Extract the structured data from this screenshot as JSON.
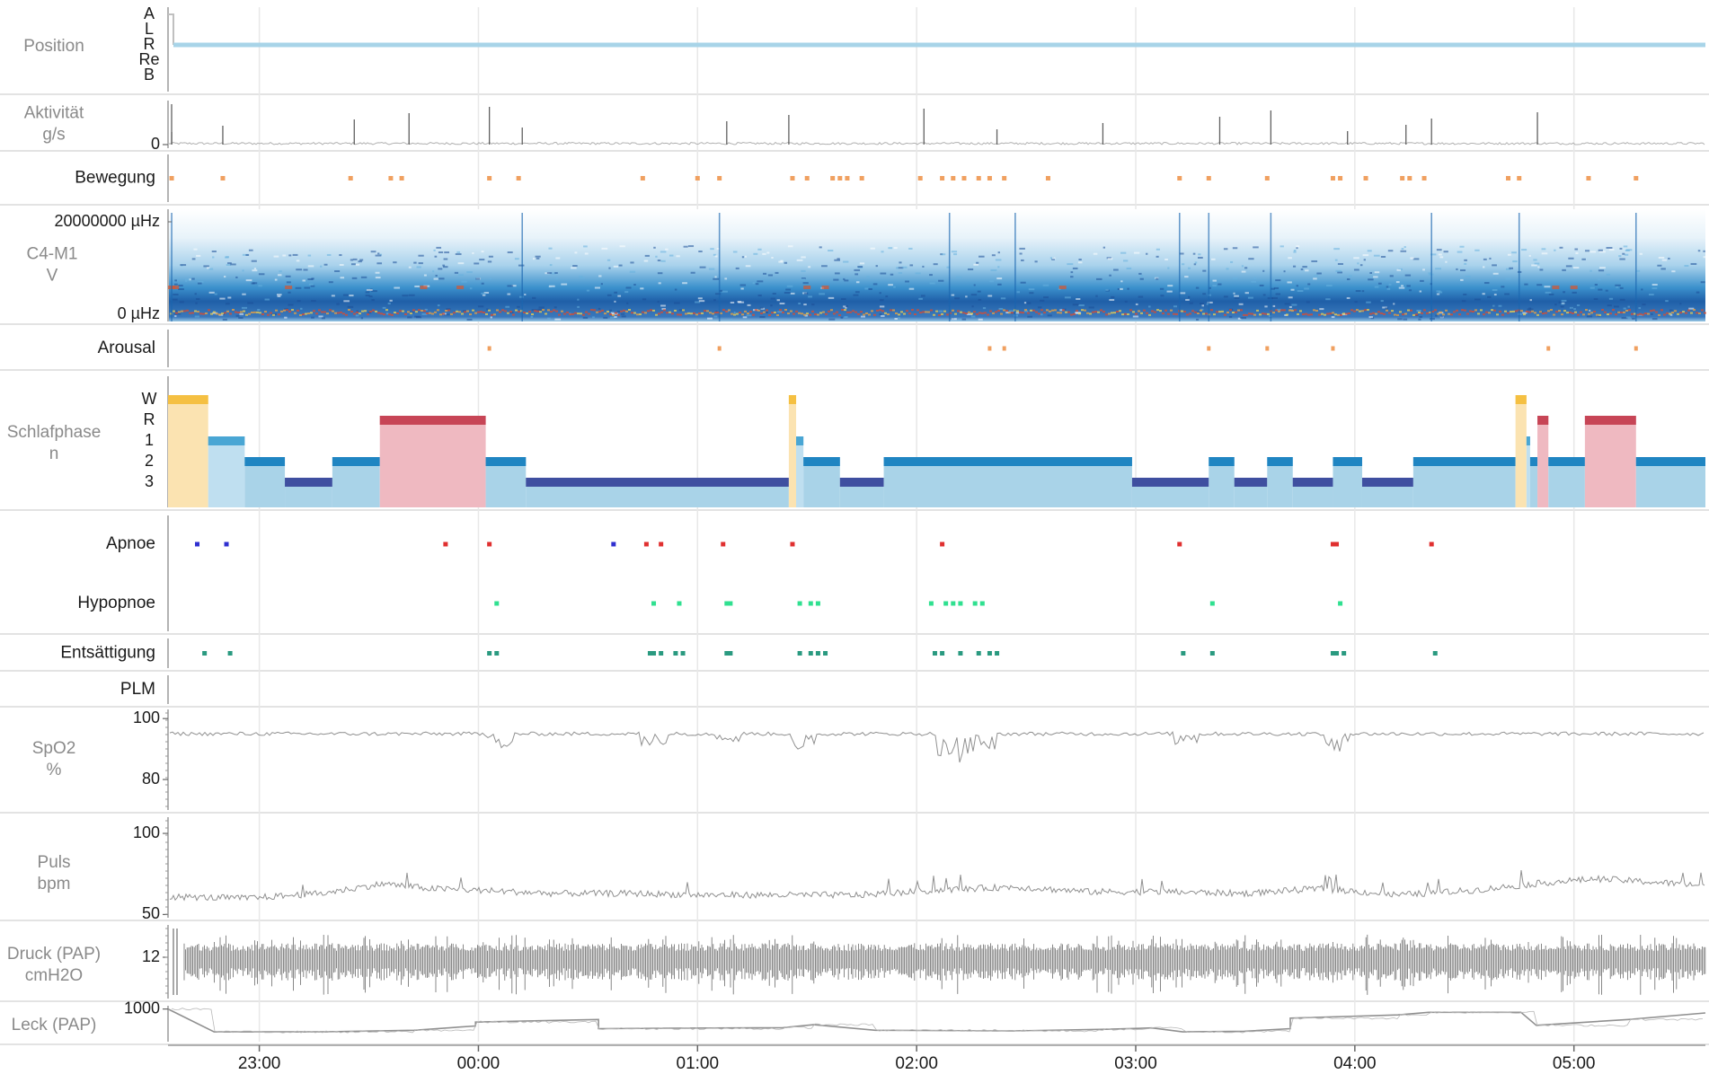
{
  "chart_data": {
    "type": "line",
    "xaxis": {
      "range": [
        "22:35",
        "05:36"
      ],
      "ticks": [
        "23:00",
        "00:00",
        "01:00",
        "02:00",
        "03:00",
        "04:00",
        "05:00"
      ],
      "grid": true
    },
    "panels": [
      {
        "id": "position",
        "label": [
          "Position"
        ],
        "type": "line",
        "yticks": [
          "A",
          "L",
          "R",
          "Re",
          "B"
        ],
        "color": "#a8d4e8",
        "segments": [
          {
            "from": "22:35",
            "to": "22:37",
            "value": "A"
          },
          {
            "from": "22:37",
            "to": "05:36",
            "value": "R"
          }
        ]
      },
      {
        "id": "aktivitaet",
        "label": [
          "Aktivität",
          "g/s"
        ],
        "type": "line",
        "yticks": [
          "0"
        ],
        "color": "#606060",
        "spikes": [
          "22:36",
          "22:50",
          "23:26",
          "23:41",
          "00:03",
          "00:12",
          "01:08",
          "01:25",
          "02:02",
          "02:22",
          "02:51",
          "03:23",
          "03:37",
          "03:58",
          "04:14",
          "04:21",
          "04:50"
        ]
      },
      {
        "id": "bewegung",
        "label": [
          "Bewegung"
        ],
        "type": "scatter",
        "color": "#f0a060",
        "events": [
          "22:36",
          "22:50",
          "23:25",
          "23:36",
          "23:39",
          "00:03",
          "00:11",
          "00:45",
          "01:00",
          "01:06",
          "01:26",
          "01:30",
          "01:37",
          "01:39",
          "01:41",
          "01:45",
          "02:01",
          "02:07",
          "02:10",
          "02:13",
          "02:17",
          "02:20",
          "02:24",
          "02:36",
          "03:12",
          "03:20",
          "03:36",
          "03:54",
          "03:56",
          "04:03",
          "04:13",
          "04:15",
          "04:19",
          "04:42",
          "04:45",
          "05:04",
          "05:17"
        ]
      },
      {
        "id": "c4m1",
        "label": [
          "C4-M1",
          "V"
        ],
        "type": "heatmap",
        "yticks": [
          "20000000 µHz",
          "0 µHz"
        ]
      },
      {
        "id": "arousal",
        "label": [
          "Arousal"
        ],
        "type": "scatter",
        "color": "#f0a060",
        "events": [
          "00:03",
          "01:06",
          "02:20",
          "02:24",
          "03:20",
          "03:36",
          "03:54",
          "04:53",
          "05:17"
        ]
      },
      {
        "id": "schlafphase",
        "label": [
          "Schlafphase",
          "n"
        ],
        "type": "area",
        "yticks": [
          "W",
          "R",
          "1",
          "2",
          "3"
        ],
        "stage_colors": {
          "W": "#f5c042",
          "R": "#c74556",
          "1": "#49a6d4",
          "2": "#1f85c2",
          "3": "#3f4fa0"
        },
        "stage_fills": {
          "W": "#fbe3b1",
          "R": "#efb9c1",
          "1": "#bfdff0",
          "2": "#a9d3e8",
          "3": "#a9d3e8"
        },
        "hypnogram": [
          {
            "start": "22:35",
            "end": "22:46",
            "stage": "W"
          },
          {
            "start": "22:46",
            "end": "22:56",
            "stage": "1"
          },
          {
            "start": "22:56",
            "end": "23:07",
            "stage": "2"
          },
          {
            "start": "23:07",
            "end": "23:20",
            "stage": "3"
          },
          {
            "start": "23:20",
            "end": "23:33",
            "stage": "2"
          },
          {
            "start": "23:33",
            "end": "00:02",
            "stage": "R"
          },
          {
            "start": "00:02",
            "end": "00:13",
            "stage": "2"
          },
          {
            "start": "00:13",
            "end": "01:25",
            "stage": "3"
          },
          {
            "start": "01:25",
            "end": "01:27",
            "stage": "W"
          },
          {
            "start": "01:27",
            "end": "01:29",
            "stage": "1"
          },
          {
            "start": "01:29",
            "end": "01:39",
            "stage": "2"
          },
          {
            "start": "01:39",
            "end": "01:51",
            "stage": "3"
          },
          {
            "start": "01:51",
            "end": "02:59",
            "stage": "2"
          },
          {
            "start": "02:59",
            "end": "03:20",
            "stage": "3"
          },
          {
            "start": "03:20",
            "end": "03:27",
            "stage": "2"
          },
          {
            "start": "03:27",
            "end": "03:36",
            "stage": "3"
          },
          {
            "start": "03:36",
            "end": "03:43",
            "stage": "2"
          },
          {
            "start": "03:43",
            "end": "03:54",
            "stage": "3"
          },
          {
            "start": "03:54",
            "end": "04:02",
            "stage": "2"
          },
          {
            "start": "04:02",
            "end": "04:16",
            "stage": "3"
          },
          {
            "start": "04:16",
            "end": "04:44",
            "stage": "2"
          },
          {
            "start": "04:44",
            "end": "04:47",
            "stage": "W"
          },
          {
            "start": "04:47",
            "end": "04:48",
            "stage": "1"
          },
          {
            "start": "04:48",
            "end": "04:50",
            "stage": "2"
          },
          {
            "start": "04:50",
            "end": "04:53",
            "stage": "R"
          },
          {
            "start": "04:53",
            "end": "05:03",
            "stage": "2"
          },
          {
            "start": "05:03",
            "end": "05:17",
            "stage": "R"
          },
          {
            "start": "05:17",
            "end": "05:36",
            "stage": "2"
          }
        ]
      },
      {
        "id": "respiratory",
        "type": "scatter",
        "rows": [
          {
            "name": "Apnoe",
            "events": [
              {
                "t": "22:43",
                "color": "#3030d0"
              },
              {
                "t": "22:51",
                "color": "#3030d0"
              },
              {
                "t": "23:51",
                "color": "#e03030"
              },
              {
                "t": "00:03",
                "color": "#e03030"
              },
              {
                "t": "00:37",
                "color": "#3030d0"
              },
              {
                "t": "00:46",
                "color": "#e03030"
              },
              {
                "t": "00:50",
                "color": "#e03030"
              },
              {
                "t": "01:07",
                "color": "#e03030"
              },
              {
                "t": "01:26",
                "color": "#e03030"
              },
              {
                "t": "02:07",
                "color": "#e03030"
              },
              {
                "t": "03:12",
                "color": "#e03030"
              },
              {
                "t": "03:54",
                "color": "#e03030"
              },
              {
                "t": "03:55",
                "color": "#e03030"
              },
              {
                "t": "04:21",
                "color": "#e03030"
              }
            ]
          },
          {
            "name": "Hypopnoe",
            "color": "#30e090",
            "events": [
              "00:05",
              "00:48",
              "00:55",
              "01:08",
              "01:09",
              "01:28",
              "01:31",
              "01:33",
              "02:04",
              "02:08",
              "02:10",
              "02:12",
              "02:16",
              "02:18",
              "03:21",
              "03:56"
            ]
          }
        ]
      },
      {
        "id": "entsaettigung",
        "label": [
          "Entsättigung"
        ],
        "type": "scatter",
        "color": "#2a9a80",
        "events": [
          "22:45",
          "22:52",
          "00:03",
          "00:05",
          "00:47",
          "00:48",
          "00:50",
          "00:54",
          "00:56",
          "01:08",
          "01:09",
          "01:28",
          "01:31",
          "01:33",
          "01:35",
          "02:05",
          "02:07",
          "02:12",
          "02:17",
          "02:20",
          "02:22",
          "03:13",
          "03:21",
          "03:54",
          "03:55",
          "03:57",
          "04:22"
        ]
      },
      {
        "id": "plm",
        "label": [
          "PLM"
        ],
        "type": "scatter",
        "events": []
      },
      {
        "id": "spo2",
        "label": [
          "SpO2",
          "%"
        ],
        "type": "line",
        "yticks": [
          "100",
          "80"
        ],
        "ylim": [
          70,
          103
        ],
        "baseline": 95,
        "color": "#909090",
        "dips": [
          {
            "t": "00:06",
            "v": 90
          },
          {
            "t": "00:48",
            "v": 90
          },
          {
            "t": "01:08",
            "v": 91
          },
          {
            "t": "01:29",
            "v": 89
          },
          {
            "t": "02:09",
            "v": 87
          },
          {
            "t": "02:14",
            "v": 85
          },
          {
            "t": "02:18",
            "v": 89
          },
          {
            "t": "03:14",
            "v": 91
          },
          {
            "t": "03:55",
            "v": 89
          }
        ]
      },
      {
        "id": "puls",
        "label": [
          "Puls",
          "bpm"
        ],
        "type": "line",
        "yticks": [
          "100",
          "50"
        ],
        "ylim": [
          48,
          110
        ],
        "color": "#909090",
        "values": [
          [
            0,
            61
          ],
          [
            0.05,
            60
          ],
          [
            0.1,
            63
          ],
          [
            0.14,
            69
          ],
          [
            0.17,
            66
          ],
          [
            0.2,
            65
          ],
          [
            0.25,
            63
          ],
          [
            0.3,
            63
          ],
          [
            0.35,
            62
          ],
          [
            0.4,
            62
          ],
          [
            0.45,
            62
          ],
          [
            0.5,
            65
          ],
          [
            0.55,
            67
          ],
          [
            0.6,
            64
          ],
          [
            0.65,
            64
          ],
          [
            0.7,
            63
          ],
          [
            0.75,
            66
          ],
          [
            0.8,
            62
          ],
          [
            0.85,
            65
          ],
          [
            0.9,
            70
          ],
          [
            0.93,
            72
          ],
          [
            1,
            68
          ]
        ]
      },
      {
        "id": "druck",
        "label": [
          "Druck (PAP)",
          "cmH2O"
        ],
        "type": "line",
        "yticks": [
          "12"
        ],
        "color": "#505050"
      },
      {
        "id": "leck",
        "label": [
          "Leck (PAP)"
        ],
        "type": "line",
        "yticks": [
          "1000"
        ],
        "ylim": [
          0,
          1100
        ],
        "color": "#909090",
        "values": [
          [
            0,
            1000
          ],
          [
            0.03,
            300
          ],
          [
            0.1,
            300
          ],
          [
            0.16,
            350
          ],
          [
            0.2,
            480
          ],
          [
            0.2,
            600
          ],
          [
            0.28,
            680
          ],
          [
            0.28,
            400
          ],
          [
            0.4,
            430
          ],
          [
            0.42,
            520
          ],
          [
            0.46,
            350
          ],
          [
            0.55,
            330
          ],
          [
            0.61,
            380
          ],
          [
            0.64,
            420
          ],
          [
            0.66,
            300
          ],
          [
            0.7,
            320
          ],
          [
            0.73,
            400
          ],
          [
            0.73,
            720
          ],
          [
            0.8,
            820
          ],
          [
            0.82,
            900
          ],
          [
            0.88,
            900
          ],
          [
            0.89,
            500
          ],
          [
            0.95,
            680
          ],
          [
            1,
            880
          ]
        ]
      }
    ]
  }
}
